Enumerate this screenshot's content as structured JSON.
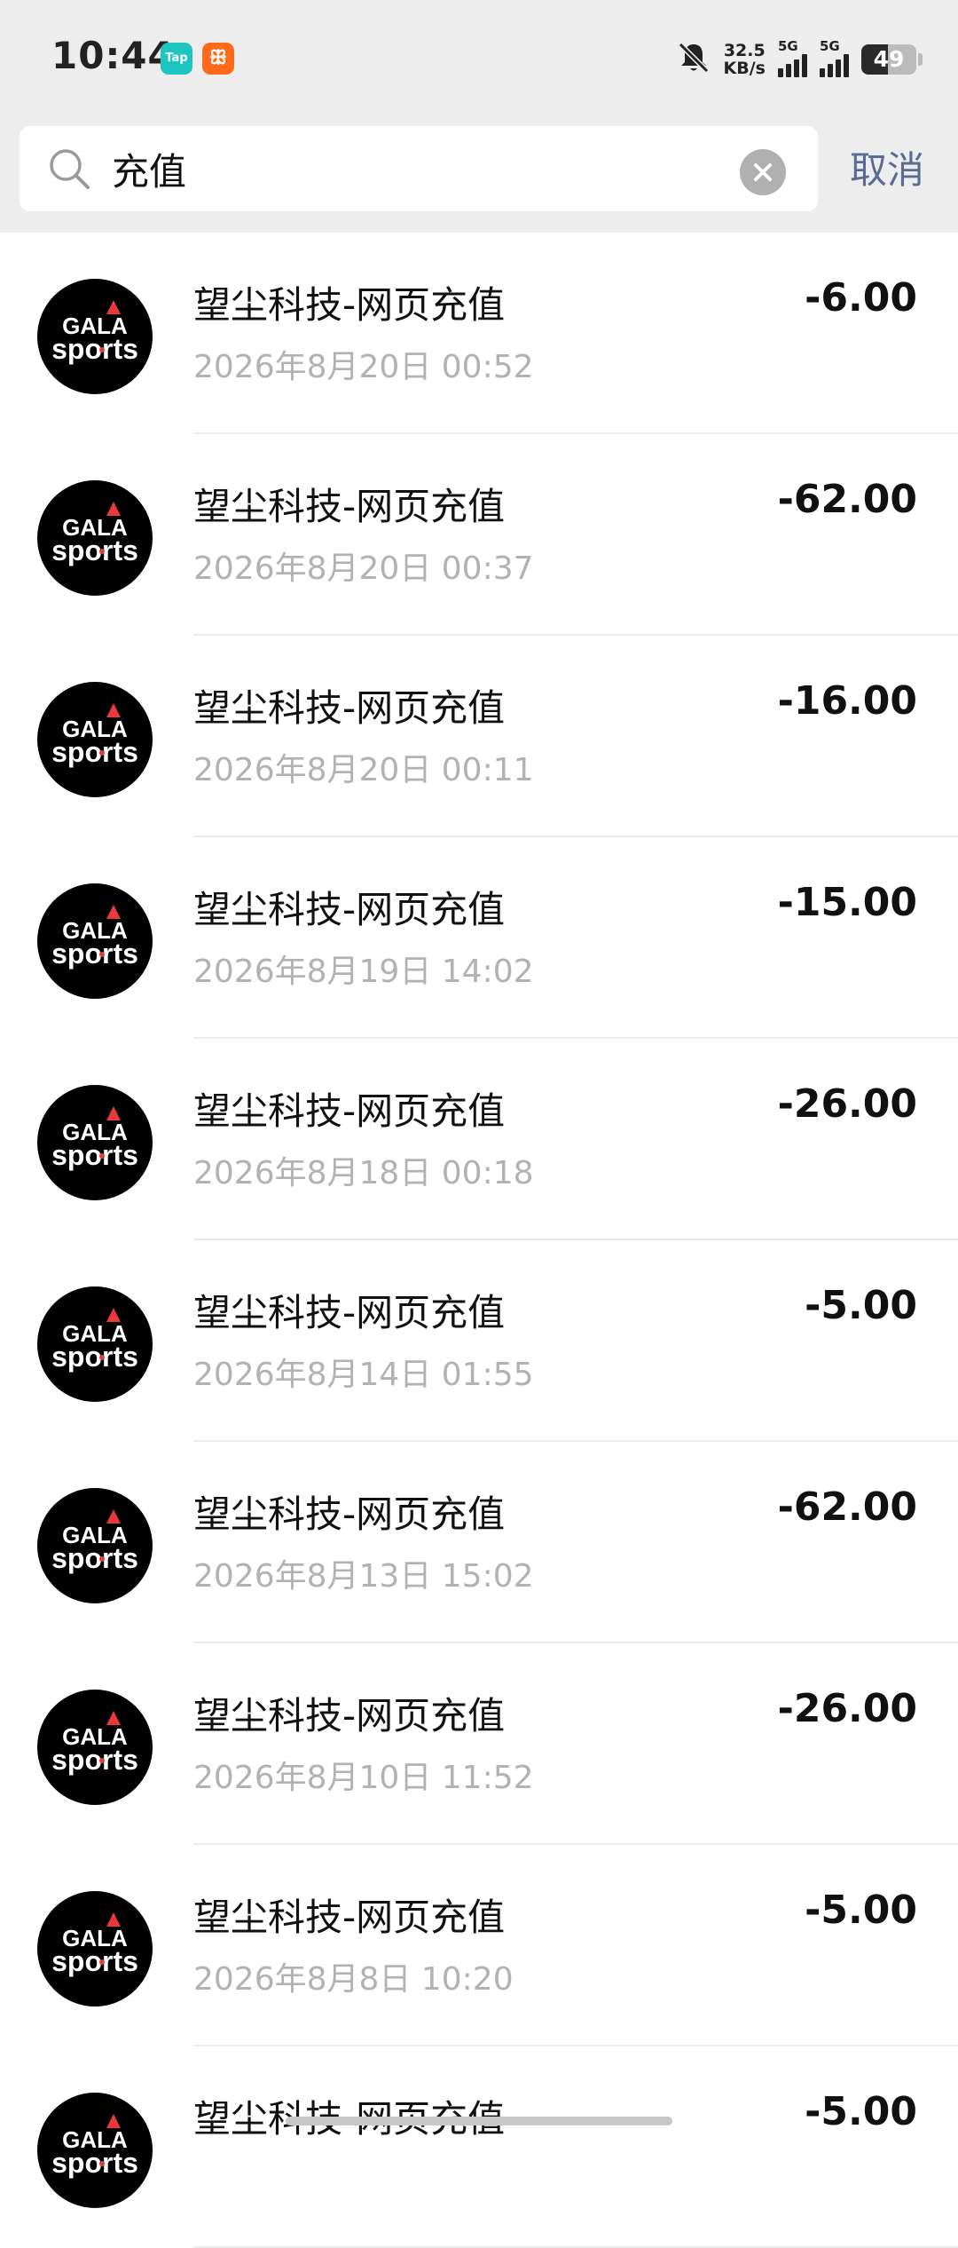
{
  "status_bar": {
    "time": "10:44",
    "app_badges": [
      {
        "icon": "taptap-icon",
        "label": "Tap"
      },
      {
        "icon": "app-icon",
        "label": "ꕥ"
      }
    ],
    "net_speed_value": "32.5",
    "net_speed_unit": "KB/s",
    "signal_1_label": "5G",
    "signal_2_label": "5G",
    "battery_level": "49",
    "battery_percent": 49
  },
  "search": {
    "query": "充值",
    "clear_icon": "clear-icon",
    "cancel_label": "取消"
  },
  "colors": {
    "link": "#576b95",
    "date_gray": "#b2b2b2",
    "avatar_bg": "#000000",
    "avatar_accent": "#e83a3a"
  },
  "transactions": [
    {
      "title": "望尘科技-网页充值",
      "date": "2026年8月20日 00:52",
      "amount": "-6.00"
    },
    {
      "title": "望尘科技-网页充值",
      "date": "2026年8月20日 00:37",
      "amount": "-62.00"
    },
    {
      "title": "望尘科技-网页充值",
      "date": "2026年8月20日 00:11",
      "amount": "-16.00"
    },
    {
      "title": "望尘科技-网页充值",
      "date": "2026年8月19日 14:02",
      "amount": "-15.00"
    },
    {
      "title": "望尘科技-网页充值",
      "date": "2026年8月18日 00:18",
      "amount": "-26.00"
    },
    {
      "title": "望尘科技-网页充值",
      "date": "2026年8月14日 01:55",
      "amount": "-5.00"
    },
    {
      "title": "望尘科技-网页充值",
      "date": "2026年8月13日 15:02",
      "amount": "-62.00"
    },
    {
      "title": "望尘科技-网页充值",
      "date": "2026年8月10日 11:52",
      "amount": "-26.00"
    },
    {
      "title": "望尘科技-网页充值",
      "date": "2026年8月8日 10:20",
      "amount": "-5.00"
    },
    {
      "title": "望尘科技-网页充值",
      "date": "",
      "amount": "-5.00"
    }
  ],
  "avatar_logo": {
    "icon": "gala-sports-logo-icon",
    "line1": "GALA",
    "line2": "sports"
  }
}
